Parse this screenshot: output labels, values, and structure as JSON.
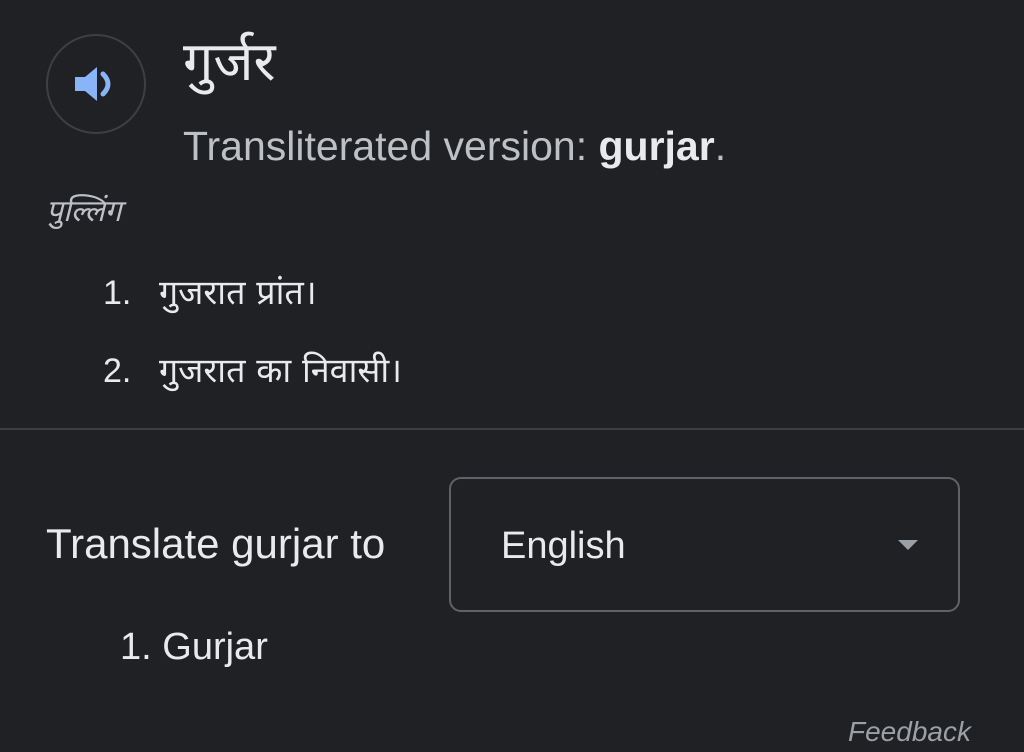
{
  "entry": {
    "word": "गुर्जर",
    "transliteration_prefix": "Transliterated version: ",
    "transliteration_value": "gurjar",
    "transliteration_suffix": ".",
    "part_of_speech": "पुल्लिंग",
    "definitions": [
      {
        "number": "1.",
        "text": "गुजरात प्रांत।"
      },
      {
        "number": "2.",
        "text": "गुजरात का निवासी।"
      }
    ],
    "speaker_icon": "volume-icon"
  },
  "translate": {
    "label": "Translate gurjar to",
    "selected_language": "English",
    "results": [
      {
        "number": "1.",
        "text": "Gurjar"
      }
    ]
  },
  "footer": {
    "feedback_label": "Feedback"
  },
  "colors": {
    "background": "#202124",
    "icon_blue": "#8ab4f8",
    "border": "#3c4043"
  }
}
